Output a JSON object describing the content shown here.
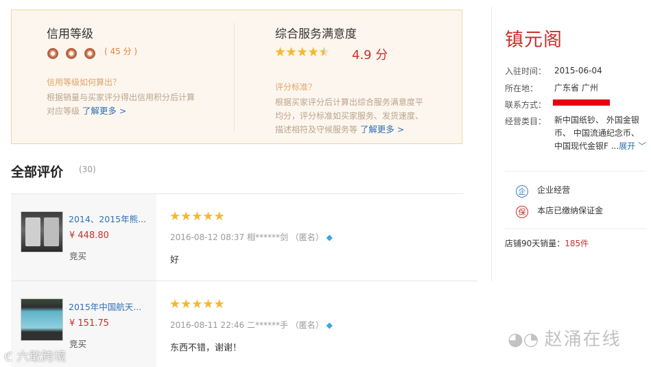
{
  "rating_panel": {
    "credit": {
      "title": "信用等级",
      "count_text": "( 45 分 )",
      "question": "信用等级如何算出？",
      "desc_line1": "根据销量与买家评分得出信用积分后计算",
      "desc_line2": "对应等级",
      "learn_more": "了解更多 >"
    },
    "service": {
      "title": "综合服务满意度",
      "score": "4.9 分",
      "rating_value": 4.5,
      "question": "评分标准？",
      "desc_line1": "根据买家评分后计算出综合服务满意度平",
      "desc_line2": "均分，评分标准如买家服务、发货速度、",
      "desc_line3": "描述相符及守候服务等",
      "learn_more": "了解更多 >"
    }
  },
  "reviews": {
    "title": "全部评价",
    "count": "(30)",
    "items": [
      {
        "product": "2014、2015年熊...",
        "price": "¥ 448.80",
        "bought": "竞买",
        "stars": 5,
        "meta": "2016-08-12 08:37 相******剑 （匿名）",
        "comment": "好"
      },
      {
        "product": "2015年中国航天...",
        "price": "¥ 151.75",
        "bought": "竞买",
        "stars": 5,
        "meta": "2016-08-11 22:46 二******手 （匿名）",
        "comment": "东西不错，谢谢！"
      }
    ]
  },
  "shop": {
    "name": "镇元阁",
    "joined_label": "入驻时间：",
    "joined_value": "2015-06-04",
    "location_label": "所在地：",
    "location_value": "广东省 广州",
    "contact_label": "联系方式：",
    "category_label": "经营类目：",
    "category_line1": "新中国纸钞、 外国金银",
    "category_line2": "币、 中国流通纪念币、",
    "category_line3": "中国现代金银F ...",
    "expand": "展开",
    "enterprise_badge": "企",
    "enterprise_text": "企业经营",
    "deposit_badge": "保",
    "deposit_text": "本店已缴纳保证金",
    "sales_prefix": "店铺90天销量：",
    "sales_value": "185件"
  },
  "watermarks": {
    "wechat": "赵涌在线",
    "brand": "六敢跨境"
  },
  "colors": {
    "accent_red": "#c9302c",
    "link_blue": "#2d6fb6",
    "star_gold": "#f5b82e",
    "panel_bg": "#fdf6ee",
    "panel_border": "#f1d2a6"
  }
}
